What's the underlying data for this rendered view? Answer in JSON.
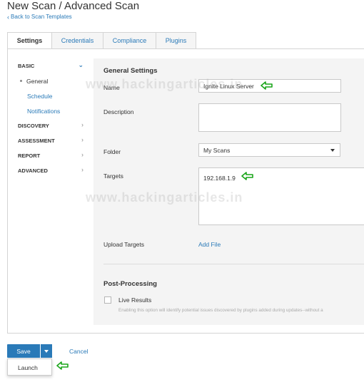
{
  "header": {
    "title": "New Scan / Advanced Scan",
    "back_link": "Back to Scan Templates"
  },
  "tabs": [
    {
      "label": "Settings",
      "active": true
    },
    {
      "label": "Credentials",
      "active": false
    },
    {
      "label": "Compliance",
      "active": false
    },
    {
      "label": "Plugins",
      "active": false
    }
  ],
  "sidebar": {
    "sections": [
      {
        "label": "BASIC",
        "open": true,
        "items": [
          "General",
          "Schedule",
          "Notifications"
        ],
        "current": "General"
      },
      {
        "label": "DISCOVERY",
        "open": false
      },
      {
        "label": "ASSESSMENT",
        "open": false
      },
      {
        "label": "REPORT",
        "open": false
      },
      {
        "label": "ADVANCED",
        "open": false
      }
    ]
  },
  "general_settings": {
    "heading": "General Settings",
    "name_label": "Name",
    "name_value": "Ignite Linux Server",
    "description_label": "Description",
    "description_value": "",
    "folder_label": "Folder",
    "folder_value": "My Scans",
    "targets_label": "Targets",
    "targets_value": "192.168.1.9",
    "upload_targets_label": "Upload Targets",
    "add_file_link": "Add File"
  },
  "post_processing": {
    "heading": "Post-Processing",
    "live_results_label": "Live Results",
    "live_results_checked": false,
    "live_results_hint": "Enabling this option will identify potential issues discovered by plugins added during updates--without a"
  },
  "footer": {
    "save_label": "Save",
    "cancel_label": "Cancel",
    "dropdown_item": "Launch"
  },
  "watermark": "www.hackingarticles.in",
  "icons": {
    "annotation_arrow": "green-left-arrow-icon",
    "back": "chevron-left-icon",
    "expand": "chevron-down-icon",
    "collapse": "chevron-right-icon",
    "select": "caret-down-icon"
  },
  "colors": {
    "accent": "#2a7ab8",
    "annotation": "#1aa51a",
    "panel_bg": "#f4f4f4"
  }
}
